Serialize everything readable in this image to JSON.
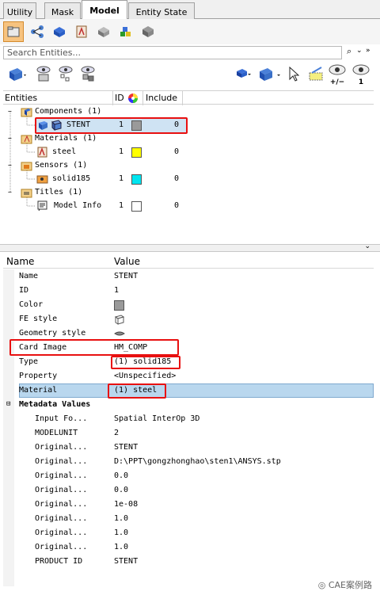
{
  "tabs": [
    {
      "label": "Utility",
      "active": false
    },
    {
      "label": "Mask",
      "active": false
    },
    {
      "label": "Model",
      "active": true
    },
    {
      "label": "Entity State",
      "active": false
    }
  ],
  "search": {
    "placeholder": "Search Entities..."
  },
  "tree": {
    "headers": {
      "entities": "Entities",
      "id": "ID",
      "include": "Include"
    },
    "rows": [
      {
        "label": "Components (1)",
        "id": "",
        "include": "",
        "color": ""
      },
      {
        "label": "STENT",
        "id": "1",
        "include": "0",
        "color": "#9a9a9a"
      },
      {
        "label": "Materials (1)",
        "id": "",
        "include": "",
        "color": ""
      },
      {
        "label": "steel",
        "id": "1",
        "include": "0",
        "color": "#ffff00"
      },
      {
        "label": "Sensors (1)",
        "id": "",
        "include": "",
        "color": ""
      },
      {
        "label": "solid185",
        "id": "1",
        "include": "0",
        "color": "#00e5f0"
      },
      {
        "label": "Titles (1)",
        "id": "",
        "include": "",
        "color": ""
      },
      {
        "label": "Model Info",
        "id": "1",
        "include": "0",
        "color": "#ffffff"
      }
    ]
  },
  "props": {
    "headers": {
      "name": "Name",
      "value": "Value"
    },
    "rows": [
      {
        "key": "Name",
        "value": "STENT"
      },
      {
        "key": "ID",
        "value": "1"
      },
      {
        "key": "Color",
        "value": ""
      },
      {
        "key": "FE style",
        "value": ""
      },
      {
        "key": "Geometry style",
        "value": ""
      },
      {
        "key": "Card Image",
        "value": "HM_COMP"
      },
      {
        "key": "Type",
        "value": "(1) solid185"
      },
      {
        "key": "Property",
        "value": "<Unspecified>"
      },
      {
        "key": "Material",
        "value": "(1) steel"
      }
    ],
    "metadata_title": "Metadata Values",
    "metadata": [
      {
        "key": "Input Fo...",
        "value": "Spatial InterOp 3D"
      },
      {
        "key": "MODELUNIT",
        "value": "2"
      },
      {
        "key": "Original...",
        "value": "STENT"
      },
      {
        "key": "Original...",
        "value": "D:\\PPT\\gongzhonghao\\sten1\\ANSYS.stp"
      },
      {
        "key": "Original...",
        "value": "0.0"
      },
      {
        "key": "Original...",
        "value": "0.0"
      },
      {
        "key": "Original...",
        "value": "1e-08"
      },
      {
        "key": "Original...",
        "value": "1.0"
      },
      {
        "key": "Original...",
        "value": "1.0"
      },
      {
        "key": "Original...",
        "value": "1.0"
      },
      {
        "key": "PRODUCT ID",
        "value": "STENT"
      }
    ]
  },
  "toolbar2": {
    "pm_label": "+/−",
    "one_label": "1"
  },
  "watermark": "CAE案例路"
}
